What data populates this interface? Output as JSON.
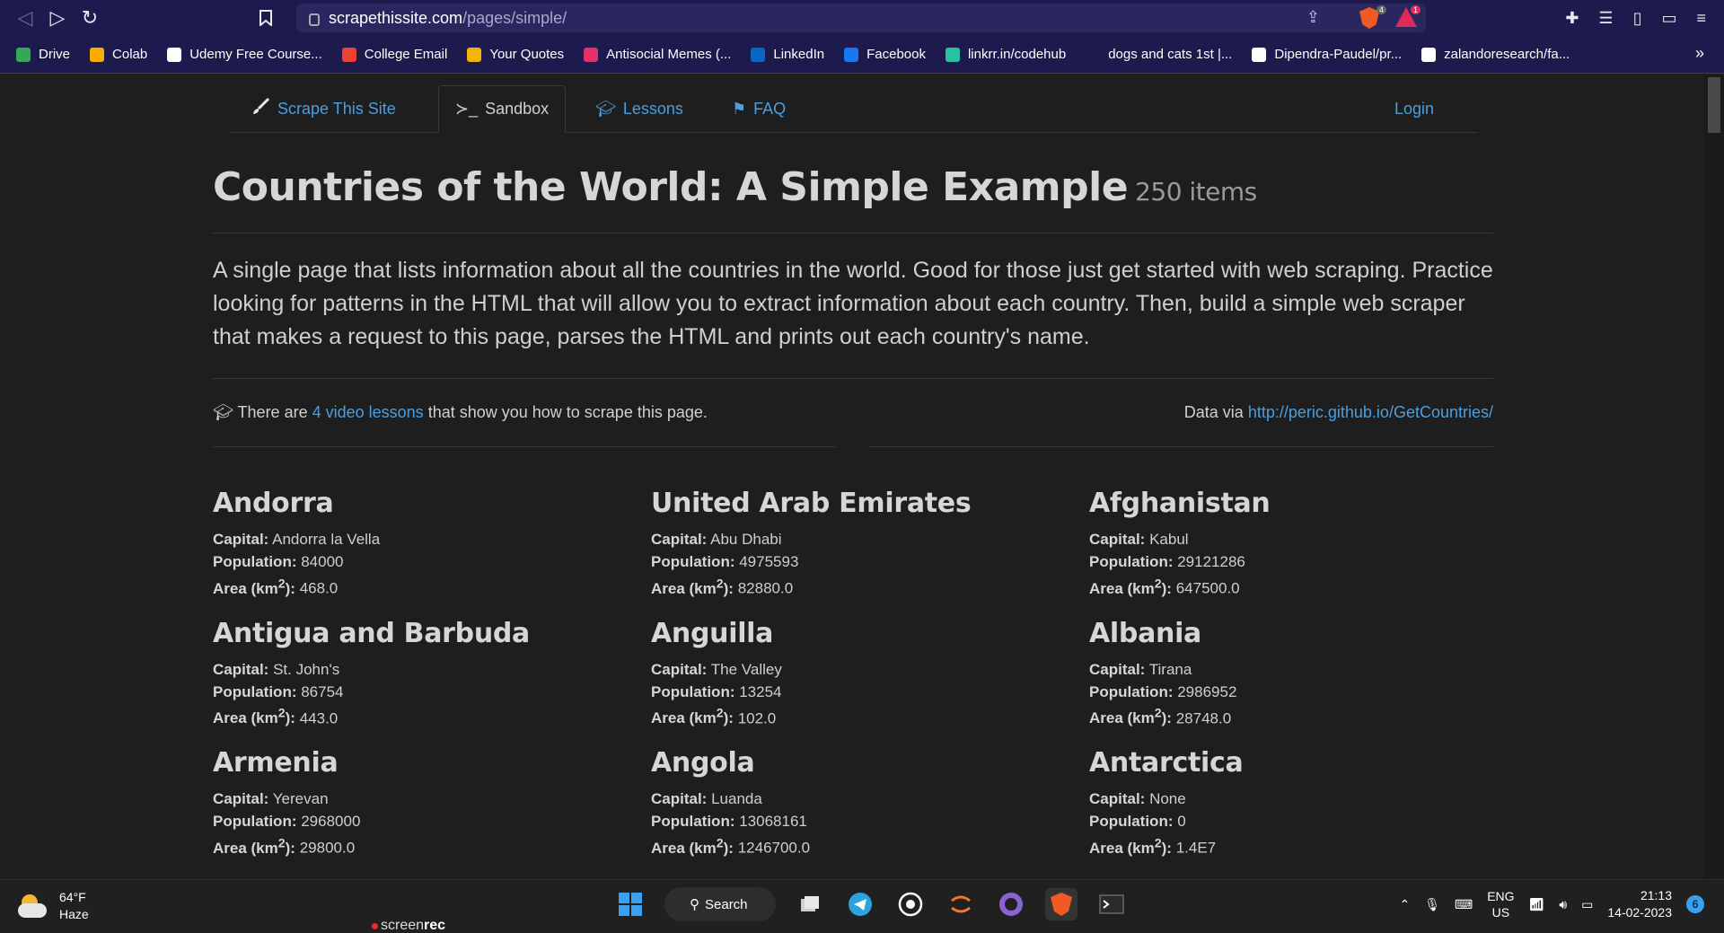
{
  "browser": {
    "url_host": "scrapethissite.com",
    "url_path": "/pages/simple/",
    "bookmarks": [
      {
        "label": "Drive",
        "color": "#34a853"
      },
      {
        "label": "Colab",
        "color": "#f9ab00"
      },
      {
        "label": "Udemy Free Course...",
        "color": "#ffffff"
      },
      {
        "label": "College Email",
        "color": "#ea4335"
      },
      {
        "label": "Your Quotes",
        "color": "#f4b400"
      },
      {
        "label": "Antisocial Memes (...",
        "color": "#e1306c"
      },
      {
        "label": "LinkedIn",
        "color": "#0a66c2"
      },
      {
        "label": "Facebook",
        "color": "#1877f2"
      },
      {
        "label": "linkrr.in/codehub",
        "color": "#27c2a0"
      },
      {
        "label": "dogs and cats 1st |...",
        "color": "#1d1a4d"
      },
      {
        "label": "Dipendra-Paudel/pr...",
        "color": "#ffffff"
      },
      {
        "label": "zalandoresearch/fa...",
        "color": "#ffffff"
      }
    ],
    "brave_badge": "4",
    "rewards_badge": "1"
  },
  "nav": {
    "brand": "Scrape This Site",
    "sandbox": "Sandbox",
    "lessons": "Lessons",
    "faq": "FAQ",
    "login": "Login"
  },
  "page": {
    "title": "Countries of the World: A Simple Example",
    "count": "250 items",
    "lead": "A single page that lists information about all the countries in the world. Good for those just get started with web scraping. Practice looking for patterns in the HTML that will allow you to extract information about each country. Then, build a simple web scraper that makes a request to this page, parses the HTML and prints out each country's name.",
    "info_prefix": "There are",
    "info_link": "4 video lessons",
    "info_suffix": "that show you how to scrape this page.",
    "data_prefix": "Data via",
    "data_link": "http://peric.github.io/GetCountries/"
  },
  "labels": {
    "capital": "Capital:",
    "population": "Population:",
    "area": "Area (km",
    "area_sup": "2",
    "area_end": "):"
  },
  "countries": [
    {
      "name": "Andorra",
      "capital": "Andorra la Vella",
      "population": "84000",
      "area": "468.0"
    },
    {
      "name": "United Arab Emirates",
      "capital": "Abu Dhabi",
      "population": "4975593",
      "area": "82880.0"
    },
    {
      "name": "Afghanistan",
      "capital": "Kabul",
      "population": "29121286",
      "area": "647500.0"
    },
    {
      "name": "Antigua and Barbuda",
      "capital": "St. John's",
      "population": "86754",
      "area": "443.0"
    },
    {
      "name": "Anguilla",
      "capital": "The Valley",
      "population": "13254",
      "area": "102.0"
    },
    {
      "name": "Albania",
      "capital": "Tirana",
      "population": "2986952",
      "area": "28748.0"
    },
    {
      "name": "Armenia",
      "capital": "Yerevan",
      "population": "2968000",
      "area": "29800.0"
    },
    {
      "name": "Angola",
      "capital": "Luanda",
      "population": "13068161",
      "area": "1246700.0"
    },
    {
      "name": "Antarctica",
      "capital": "None",
      "population": "0",
      "area": "1.4E7"
    }
  ],
  "taskbar": {
    "temperature": "64°F",
    "condition": "Haze",
    "screenrec_a": "screen",
    "screenrec_b": "rec",
    "search": "Search",
    "lang1": "ENG",
    "lang2": "US",
    "time": "21:13",
    "date": "14-02-2023",
    "notifications": "6"
  }
}
